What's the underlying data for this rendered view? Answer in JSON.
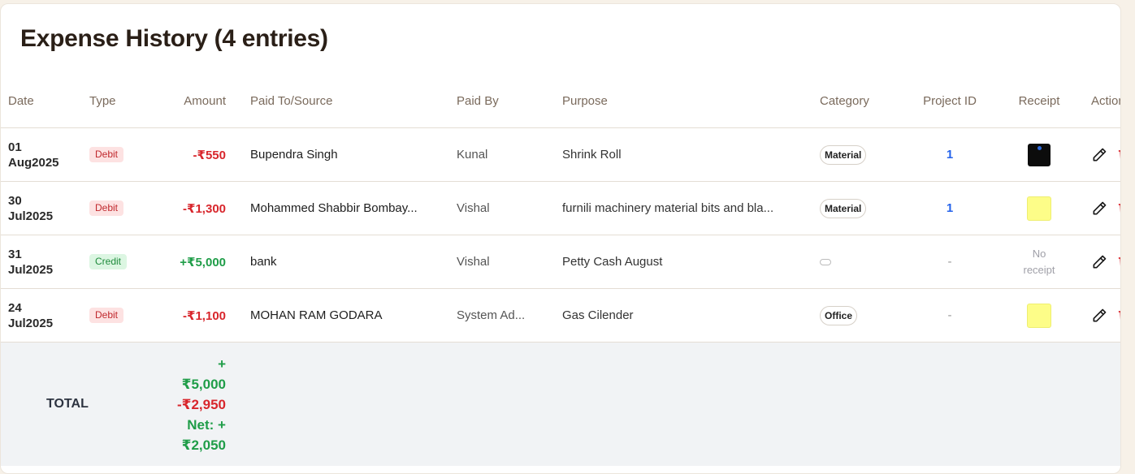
{
  "title": "Expense History (4 entries)",
  "columns": {
    "date": "Date",
    "type": "Type",
    "amount": "Amount",
    "paid_to": "Paid To/Source",
    "paid_by": "Paid By",
    "purpose": "Purpose",
    "category": "Category",
    "project_id": "Project ID",
    "receipt": "Receipt",
    "actions": "Actions"
  },
  "rows": [
    {
      "date": "01\nAug2025",
      "type": "Debit",
      "amount": "-₹550",
      "paid_to": "Bupendra Singh",
      "paid_by": "Kunal",
      "purpose": "Shrink Roll",
      "category": "Material",
      "project_id": "1",
      "receipt": "image-dark"
    },
    {
      "date": "30\nJul2025",
      "type": "Debit",
      "amount": "-₹1,300",
      "paid_to": "Mohammed Shabbir Bombay...",
      "paid_by": "Vishal",
      "purpose": "furnili machinery material bits and bla...",
      "category": "Material",
      "project_id": "1",
      "receipt": "image-yellow"
    },
    {
      "date": "31\nJul2025",
      "type": "Credit",
      "amount": "+₹5,000",
      "paid_to": "bank",
      "paid_by": "Vishal",
      "purpose": "Petty Cash August",
      "category": "",
      "project_id": "-",
      "receipt": "No\nreceipt"
    },
    {
      "date": "24\nJul2025",
      "type": "Debit",
      "amount": "-₹1,100",
      "paid_to": "MOHAN RAM GODARA",
      "paid_by": "System Ad...",
      "purpose": "Gas Cilender",
      "category": "Office",
      "project_id": "-",
      "receipt": "image-yellow"
    }
  ],
  "total": {
    "label": "TOTAL",
    "credit": "+\n₹5,000",
    "debit": "-₹2,950",
    "net": "Net: +\n₹2,050"
  },
  "icons": {
    "edit": "pencil-icon",
    "delete": "trash-icon"
  },
  "colors": {
    "debit_text": "#d8262c",
    "credit_text": "#1f9d48",
    "project_link": "#2563eb"
  }
}
